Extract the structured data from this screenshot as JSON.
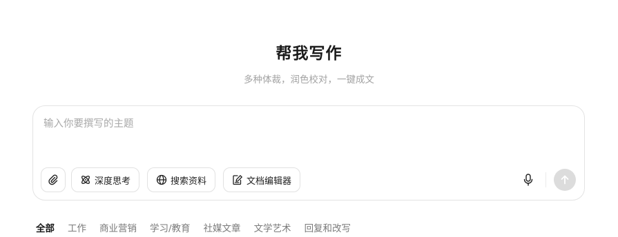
{
  "header": {
    "title": "帮我写作",
    "subtitle": "多种体裁，润色校对，一键成文"
  },
  "composer": {
    "placeholder": "输入你要撰写的主题",
    "value": "",
    "attach_icon": "paperclip-icon",
    "chips": {
      "deep_think": {
        "label": "深度思考",
        "icon": "atom-icon"
      },
      "search": {
        "label": "搜索资料",
        "icon": "globe-icon"
      },
      "editor": {
        "label": "文档编辑器",
        "icon": "edit-document-icon"
      }
    },
    "mic_icon": "microphone-icon",
    "send_icon": "arrow-up-icon",
    "send_color": "#dcdcdc"
  },
  "tabs": [
    {
      "label": "全部",
      "active": true
    },
    {
      "label": "工作"
    },
    {
      "label": "商业营销"
    },
    {
      "label": "学习/教育"
    },
    {
      "label": "社媒文章"
    },
    {
      "label": "文学艺术"
    },
    {
      "label": "回复和改写"
    }
  ]
}
